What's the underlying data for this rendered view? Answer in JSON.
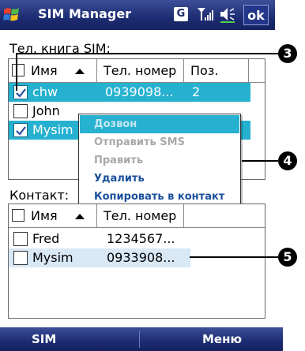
{
  "header": {
    "title": "SIM Manager",
    "g_icon_label": "G",
    "ok_label": "ok",
    "icons": [
      "windows-start-icon",
      "g-icon",
      "signal-icon",
      "volume-icon"
    ]
  },
  "sim_book": {
    "label": "Тел. книга SIM:",
    "columns": [
      "Имя",
      "Тел. номер",
      "Поз."
    ],
    "rows": [
      {
        "name": "chw",
        "number": "0939098...",
        "pos": "2",
        "checked": true,
        "selected": true
      },
      {
        "name": "John",
        "number": "",
        "pos": "",
        "checked": false,
        "selected": false
      },
      {
        "name": "Mysim",
        "number": "",
        "pos": "",
        "checked": true,
        "selected": true
      }
    ]
  },
  "context_menu": {
    "items": [
      {
        "label": "Дозвон",
        "state": "active"
      },
      {
        "label": "Отправить SMS",
        "state": "disabled"
      },
      {
        "label": "Править",
        "state": "disabled"
      },
      {
        "label": "Удалить",
        "state": "enabled"
      },
      {
        "label": "Копировать в контакт",
        "state": "enabled"
      }
    ]
  },
  "contacts": {
    "label": "Контакт:",
    "columns": [
      "Имя",
      "Тел. номер"
    ],
    "rows": [
      {
        "name": "Fred",
        "number": "1234567...",
        "checked": false
      },
      {
        "name": "Mysim",
        "number": "0933908...",
        "checked": false
      }
    ]
  },
  "callouts": [
    "3",
    "4",
    "5"
  ],
  "softkeys": {
    "left": "SIM",
    "right": "Меню"
  },
  "colors": {
    "title_bar": "#1c2c72",
    "selection": "#27b1d0",
    "check": "#2a4ea8",
    "menu_enabled_text": "#1b4f9a",
    "menu_disabled_text": "#a8a8a8"
  }
}
